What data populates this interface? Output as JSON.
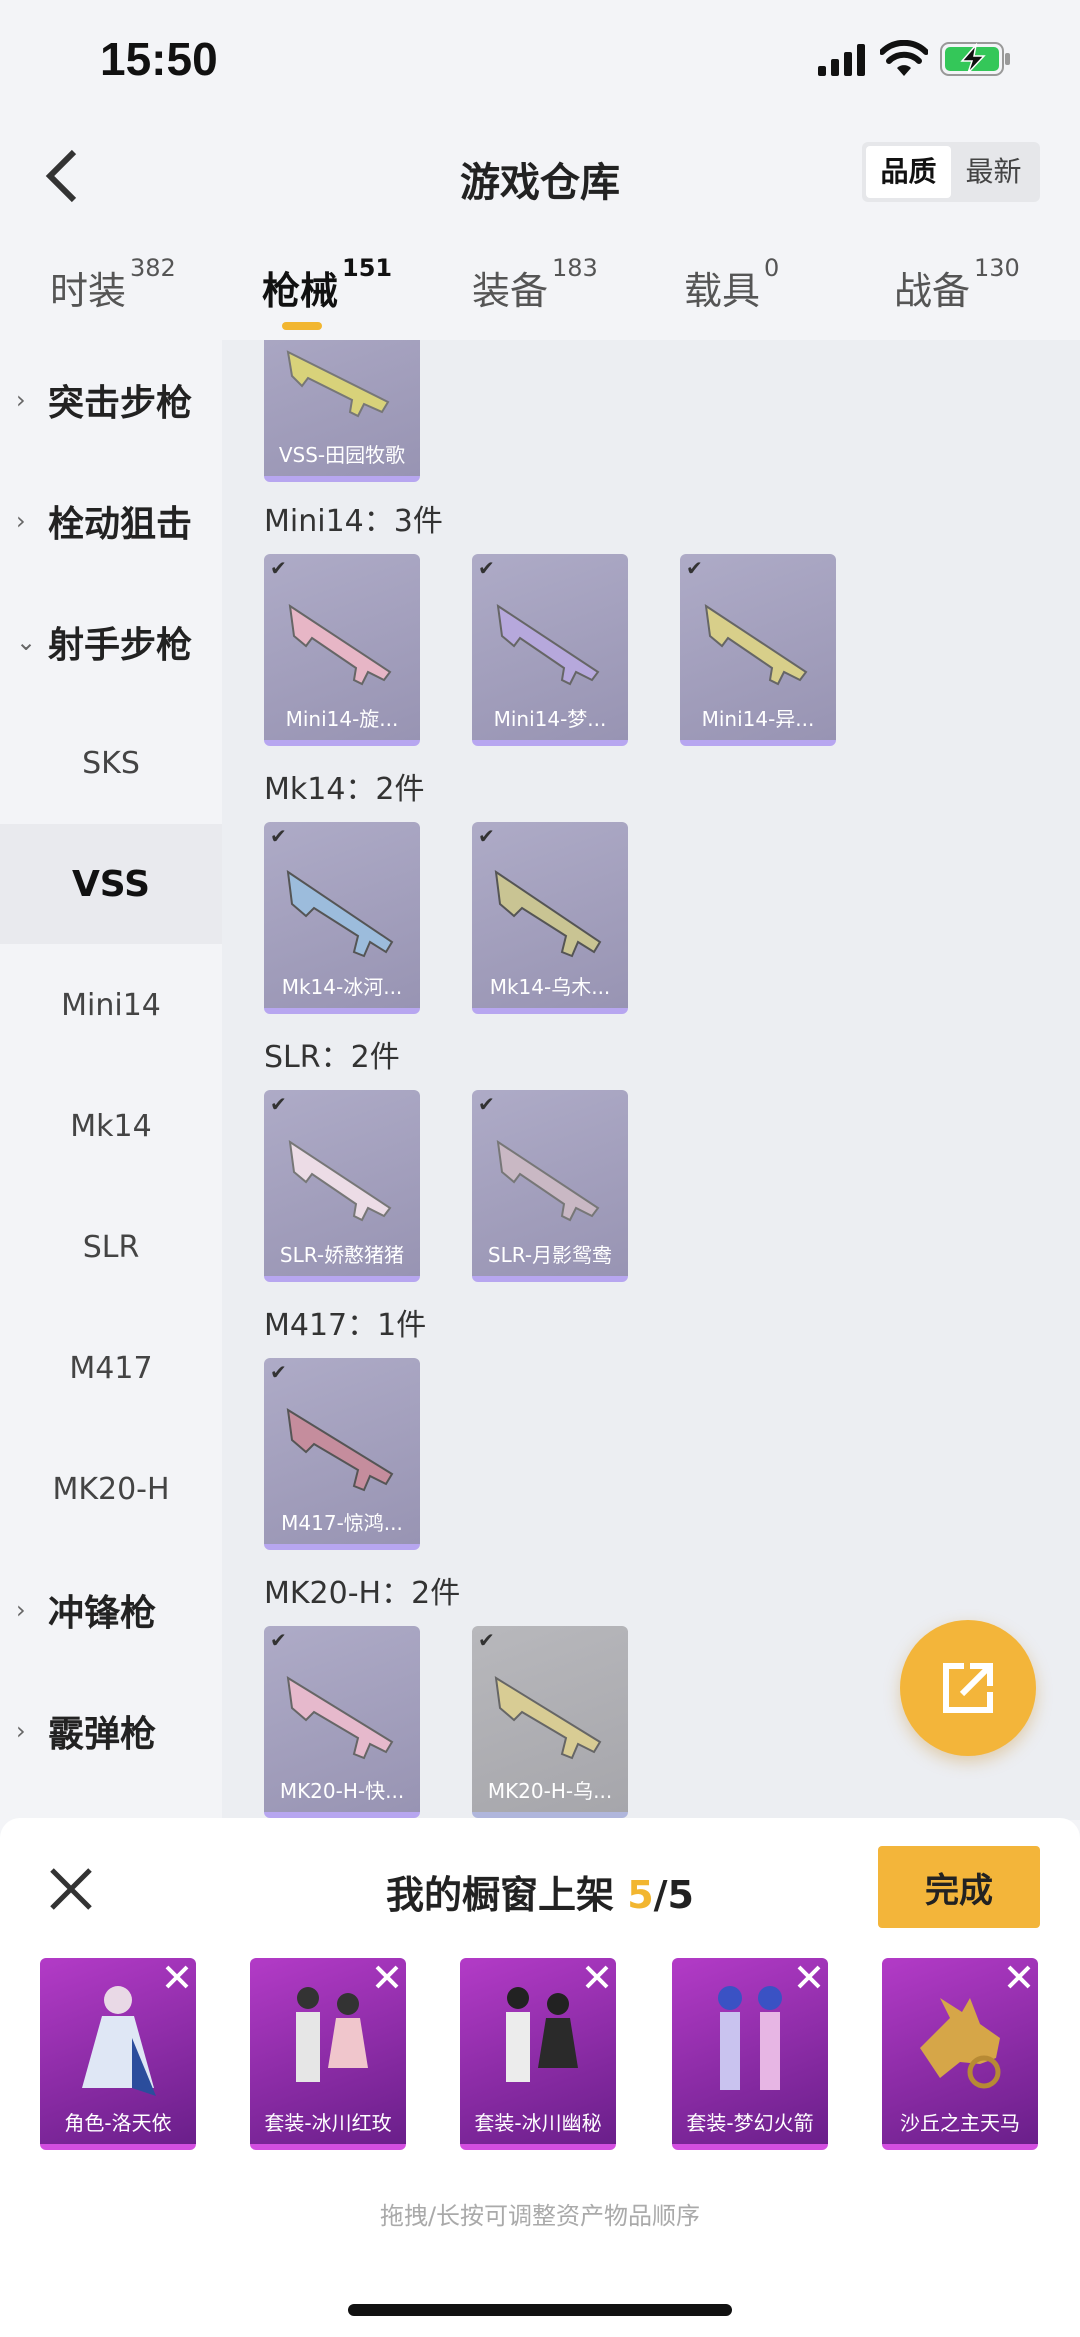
{
  "status": {
    "time": "15:50",
    "icons": [
      "signal-icon",
      "wifi-icon",
      "battery-charging-icon"
    ]
  },
  "header": {
    "title": "游戏仓库",
    "back_icon": "back-chevron-icon",
    "sort": [
      "品质",
      "最新"
    ]
  },
  "tabs": [
    {
      "label": "时装",
      "count": "382"
    },
    {
      "label": "枪械",
      "count": "151"
    },
    {
      "label": "装备",
      "count": "183"
    },
    {
      "label": "载具",
      "count": "0"
    },
    {
      "label": "战备",
      "count": "130"
    }
  ],
  "sidebar": [
    {
      "label": "突击步枪",
      "expander": "›"
    },
    {
      "label": "栓动狙击",
      "expander": "›"
    },
    {
      "label": "射手步枪",
      "expander": "⌄"
    },
    {
      "label": "SKS"
    },
    {
      "label": "VSS"
    },
    {
      "label": "Mini14"
    },
    {
      "label": "Mk14"
    },
    {
      "label": "SLR"
    },
    {
      "label": "M417"
    },
    {
      "label": "MK20-H"
    },
    {
      "label": "冲锋枪",
      "expander": "›"
    },
    {
      "label": "霰弹枪",
      "expander": "›"
    }
  ],
  "groups": [
    {
      "title": "",
      "items": [
        {
          "name": "VSS-田园牧歌",
          "color": "#d8d27a"
        }
      ]
    },
    {
      "title": "Mini14：3件",
      "items": [
        {
          "name": "Mini14-旋...",
          "color": "#e7b6c6"
        },
        {
          "name": "Mini14-梦...",
          "color": "#b6a8dc"
        },
        {
          "name": "Mini14-异...",
          "color": "#d8cf8a"
        }
      ]
    },
    {
      "title": "Mk14：2件",
      "items": [
        {
          "name": "Mk14-冰河...",
          "color": "#9cbcdc"
        },
        {
          "name": "Mk14-乌木...",
          "color": "#c9c493"
        }
      ]
    },
    {
      "title": "SLR：2件",
      "items": [
        {
          "name": "SLR-娇憨猪猪",
          "color": "#ecdce6"
        },
        {
          "name": "SLR-月影鸳鸯",
          "color": "#c9b8c4"
        }
      ]
    },
    {
      "title": "M417：1件",
      "items": [
        {
          "name": "M417-惊鸿...",
          "color": "#c58d9d"
        }
      ]
    },
    {
      "title": "MK20-H：2件",
      "items": [
        {
          "name": "MK20-H-快...",
          "color": "#e6b9cc"
        },
        {
          "name": "MK20-H-乌...",
          "color": "#d8cc94"
        }
      ]
    }
  ],
  "panel": {
    "title_prefix": "我的橱窗上架 ",
    "count": "5",
    "total": "/5",
    "done": "完成",
    "hint": "拖拽/长按可调整资产物品顺序",
    "items": [
      "角色-洛天依",
      "套装-冰川红玫",
      "套装-冰川幽秘",
      "套装-梦幻火箭",
      "沙丘之主天马"
    ]
  },
  "accent": "#f2b630"
}
